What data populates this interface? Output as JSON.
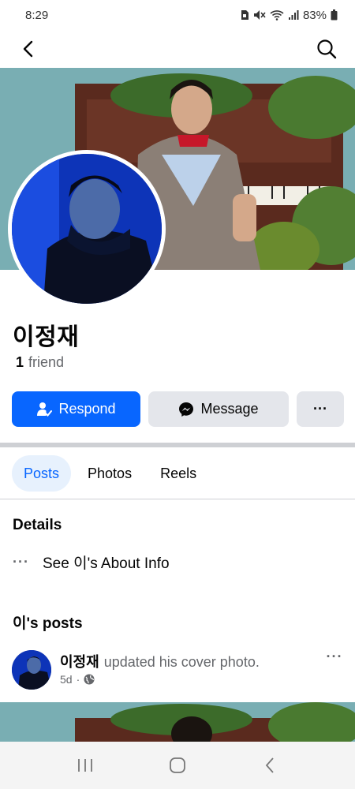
{
  "status_bar": {
    "time": "8:29",
    "battery": "83%",
    "icons": [
      "sim-icon",
      "mute-icon",
      "wifi-icon",
      "signal-icon",
      "battery-icon"
    ]
  },
  "top_nav": {
    "icons": [
      "back-arrow-icon",
      "search-icon"
    ]
  },
  "profile": {
    "name": "이정재",
    "friend_count": "1",
    "friend_label": "friend"
  },
  "actions": {
    "respond_label": "Respond",
    "message_label": "Message",
    "more_label": "···"
  },
  "tabs": [
    {
      "label": "Posts",
      "active": true
    },
    {
      "label": "Photos",
      "active": false
    },
    {
      "label": "Reels",
      "active": false
    }
  ],
  "details": {
    "title": "Details",
    "about_label": "See 이's About Info",
    "dots": "···"
  },
  "posts": {
    "title": "이's posts",
    "items": [
      {
        "author": "이정재",
        "action": "updated his cover photo.",
        "time": "5d",
        "separator": "·",
        "privacy_icon": "globe-icon",
        "more": "···"
      }
    ]
  },
  "system_nav": {
    "icons": [
      "recents-icon",
      "home-icon",
      "back-icon"
    ]
  },
  "colors": {
    "accent": "#0866ff",
    "secondary_button": "#e4e6eb",
    "active_tab_bg": "#e7f1fd",
    "muted_text": "#65676b"
  }
}
